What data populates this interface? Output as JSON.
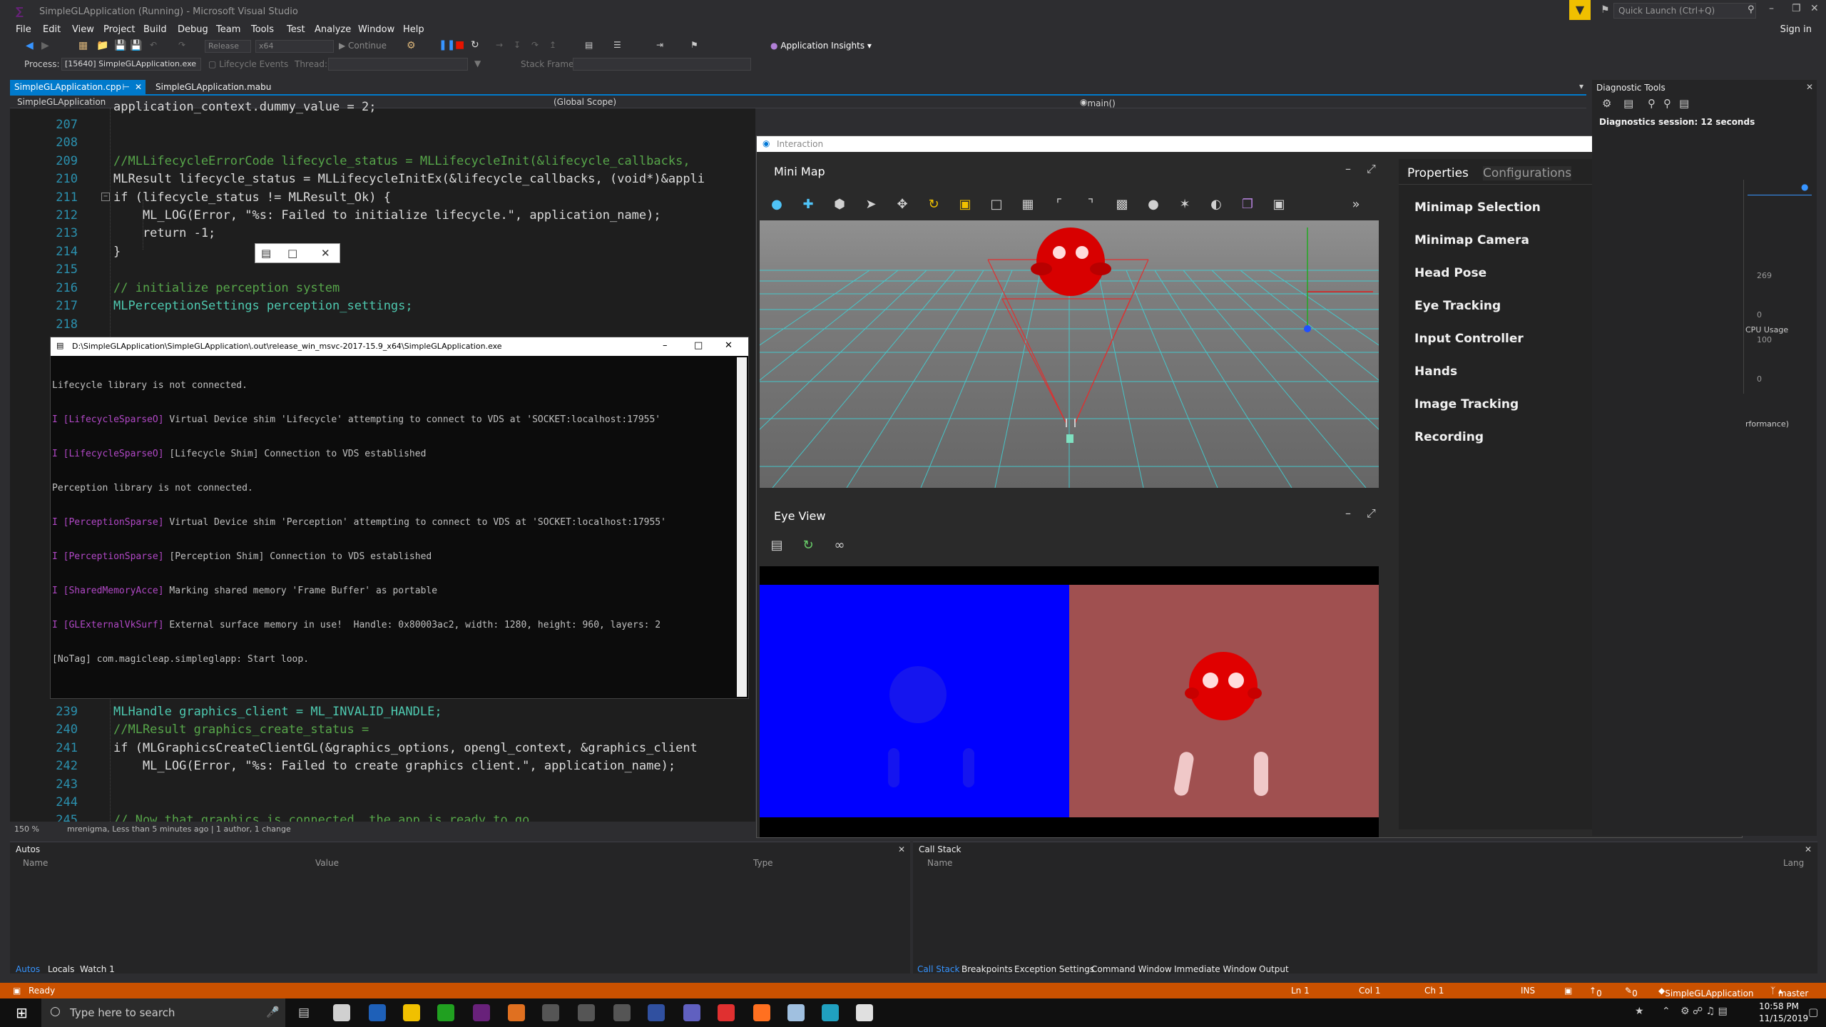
{
  "window": {
    "title": "SimpleGLApplication (Running) - Microsoft Visual Studio",
    "quick_launch_placeholder": "Quick Launch (Ctrl+Q)",
    "sign_in": "Sign in"
  },
  "menu": [
    "File",
    "Edit",
    "View",
    "Project",
    "Build",
    "Debug",
    "Team",
    "Tools",
    "Test",
    "Analyze",
    "Window",
    "Help"
  ],
  "toolbar": {
    "config": "Release",
    "platform": "x64",
    "continue": "Continue",
    "app_insights": "Application Insights",
    "process_label": "Process:",
    "process_value": "[15640] SimpleGLApplication.exe",
    "lifecycle_events": "Lifecycle Events",
    "thread_label": "Thread:",
    "stack_frame_label": "Stack Frame:"
  },
  "doc_tabs": [
    "SimpleGLApplication.cpp",
    "SimpleGLApplication.mabu"
  ],
  "nav": {
    "project": "SimpleGLApplication",
    "scope": "(Global Scope)",
    "member": "main()"
  },
  "code_top": [
    {
      "n": "207",
      "t": "application_context.dummy_value = 2;"
    },
    {
      "n": "208",
      "t": ""
    },
    {
      "n": "209",
      "t": "//MLLifecycleErrorCode lifecycle_status = MLLifecycleInit(&lifecycle_callbacks,"
    },
    {
      "n": "210",
      "t": "MLResult lifecycle_status = MLLifecycleInitEx(&lifecycle_callbacks, (void*)&appli"
    },
    {
      "n": "211",
      "t": "if (lifecycle_status != MLResult_Ok) {"
    },
    {
      "n": "212",
      "t": "    ML_LOG(Error, \"%s: Failed to initialize lifecycle.\", application_name);"
    },
    {
      "n": "213",
      "t": "    return -1;"
    },
    {
      "n": "214",
      "t": "}"
    },
    {
      "n": "215",
      "t": ""
    },
    {
      "n": "216",
      "t": "// initialize perception system"
    },
    {
      "n": "217",
      "t": "MLPerceptionSettings perception_settings;"
    },
    {
      "n": "218",
      "t": ""
    }
  ],
  "code_bottom": [
    {
      "n": "239",
      "t": "MLHandle graphics_client = ML_INVALID_HANDLE;"
    },
    {
      "n": "240",
      "t": "//MLResult graphics_create_status ="
    },
    {
      "n": "241",
      "t": "if (MLGraphicsCreateClientGL(&graphics_options, opengl_context, &graphics_client"
    },
    {
      "n": "242",
      "t": "    ML_LOG(Error, \"%s: Failed to create graphics client.\", application_name);"
    },
    {
      "n": "243",
      "t": ""
    },
    {
      "n": "244",
      "t": ""
    },
    {
      "n": "245",
      "t": "// Now that graphics is connected, the app is ready to go"
    }
  ],
  "zoom": {
    "level": "150 %",
    "blame": "mrenigma, Less than 5 minutes ago | 1 author, 1 change"
  },
  "console": {
    "title": "D:\\SimpleGLApplication\\SimpleGLApplication\\.out\\release_win_msvc-2017-15.9_x64\\SimpleGLApplication.exe",
    "lines": [
      {
        "p": "",
        "tag": "",
        "text": "Lifecycle library is not connected."
      },
      {
        "p": "I ",
        "tag": "[LifecycleSparseO]",
        "text": " Virtual Device shim 'Lifecycle' attempting to connect to VDS at 'SOCKET:localhost:17955'"
      },
      {
        "p": "I ",
        "tag": "[LifecycleSparseO]",
        "text": " [Lifecycle Shim] Connection to VDS established"
      },
      {
        "p": "",
        "tag": "",
        "text": "Perception library is not connected."
      },
      {
        "p": "I ",
        "tag": "[PerceptionSparse]",
        "text": " Virtual Device shim 'Perception' attempting to connect to VDS at 'SOCKET:localhost:17955'"
      },
      {
        "p": "I ",
        "tag": "[PerceptionSparse]",
        "text": " [Perception Shim] Connection to VDS established"
      },
      {
        "p": "I ",
        "tag": "[SharedMemoryAcce]",
        "text": " Marking shared memory 'Frame Buffer' as portable"
      },
      {
        "p": "I ",
        "tag": "[GLExternalVkSurf]",
        "text": " External surface memory in use!  Handle: 0x80003ac2, width: 1280, height: 960, layers: 2"
      },
      {
        "p": "",
        "tag": "",
        "text": "[NoTag] com.magicleap.simpleglapp: Start loop."
      }
    ]
  },
  "interaction": {
    "title": "Interaction",
    "minimap_title": "Mini Map",
    "eyeview_title": "Eye View",
    "tabs": [
      "Properties",
      "Configurations"
    ],
    "properties": [
      "Minimap Selection",
      "Minimap Camera",
      "Head Pose",
      "Eye Tracking",
      "Input Controller",
      "Hands",
      "Image Tracking",
      "Recording"
    ]
  },
  "diag": {
    "title": "Diagnostic Tools",
    "session": "Diagnostics session: 12 seconds",
    "vals": [
      "269",
      "0",
      "100",
      "0"
    ],
    "cpu": "CPU Usage",
    "perf": "rformance)"
  },
  "autos": {
    "title": "Autos",
    "cols": [
      "Name",
      "Value",
      "Type"
    ],
    "tabs": [
      "Autos",
      "Locals",
      "Watch 1"
    ]
  },
  "callstack": {
    "title": "Call Stack",
    "cols": [
      "Name",
      "Lang"
    ],
    "tabs": [
      "Call Stack",
      "Breakpoints",
      "Exception Settings",
      "Command Window",
      "Immediate Window",
      "Output"
    ]
  },
  "status": {
    "ready": "Ready",
    "ln": "Ln 1",
    "col": "Col 1",
    "ch": "Ch 1",
    "ins": "INS",
    "up": "0",
    "pencil": "0",
    "project": "SimpleGLApplication",
    "branch": "master"
  },
  "taskbar": {
    "search_placeholder": "Type here to search",
    "time": "10:58 PM",
    "date": "11/15/2019"
  },
  "colors": {
    "accent": "#007acc",
    "status": "#ca5100",
    "magenta": "#b148c6"
  }
}
